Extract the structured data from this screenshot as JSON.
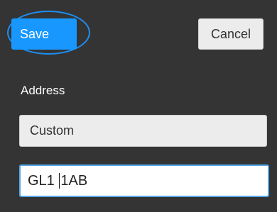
{
  "toolbar": {
    "save_label": "Save",
    "cancel_label": "Cancel"
  },
  "address": {
    "label": "Address",
    "mode_selected": "Custom",
    "postcode_before_caret": "GL1 ",
    "postcode_after_caret": "1AB"
  },
  "colors": {
    "background": "#343434",
    "accent": "#1898ff",
    "focus_ring": "#56a7ea"
  }
}
